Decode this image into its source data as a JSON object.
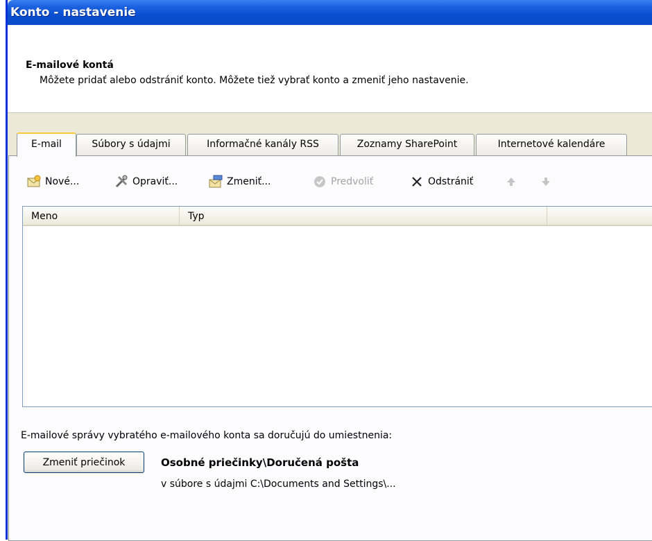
{
  "window": {
    "title": "Konto - nastavenie"
  },
  "header": {
    "title": "E-mailové kontá",
    "subtitle": "Môžete pridať alebo odstrániť konto. Môžete tiež vybrať konto a zmeniť jeho nastavenie."
  },
  "tabs": [
    {
      "label": "E-mail",
      "active": true
    },
    {
      "label": "Súbory s údajmi",
      "active": false
    },
    {
      "label": "Informačné kanály RSS",
      "active": false
    },
    {
      "label": "Zoznamy SharePoint",
      "active": false
    },
    {
      "label": "Internetové kalendáre",
      "active": false
    }
  ],
  "toolbar": {
    "new_label": "Nové...",
    "repair_label": "Opraviť...",
    "change_label": "Zmeniť...",
    "default_label": "Predvoliť",
    "remove_label": "Odstrániť",
    "default_disabled": true,
    "up_disabled": true,
    "down_disabled": true
  },
  "accounts_table": {
    "columns": [
      "Meno",
      "Typ"
    ],
    "rows": []
  },
  "delivery": {
    "note": "E-mailové správy vybratého e-mailového konta sa doručujú do umiestnenia:",
    "change_folder_label": "Zmeniť priečinok",
    "folder": "Osobné priečinky\\Doručená pošta",
    "path": "v súbore s údajmi C:\\Documents and Settings\\..."
  }
}
